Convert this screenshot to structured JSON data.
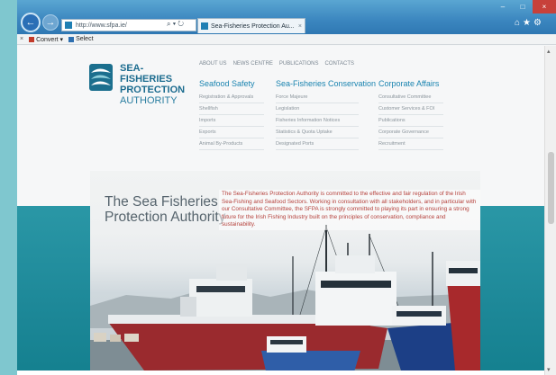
{
  "browser": {
    "address": "http://www.sfpa.ie/",
    "address_tools": "⌕ ▾ ↻",
    "tab_title": "Sea-Fisheries Protection Au...",
    "tab_close": "×",
    "window_controls": {
      "min": "–",
      "max": "□",
      "close": "×"
    },
    "right_icons": "⌂★⚙",
    "back_glyph": "←",
    "forward_glyph": "→"
  },
  "command_bar": {
    "close": "×",
    "convert": "Convert ▾",
    "select": "Select"
  },
  "logo": {
    "line1": "SEA-FISHERIES",
    "line2": "PROTECTION",
    "line3": "AUTHORITY"
  },
  "topnav": [
    "ABOUT US",
    "NEWS CENTRE",
    "PUBLICATIONS",
    "CONTACTS"
  ],
  "nav_columns": [
    {
      "heading": "Seafood Safety",
      "items": [
        "Registration & Approvals",
        "Shellfish",
        "Imports",
        "Exports",
        "Animal By-Products"
      ]
    },
    {
      "heading": "Sea-Fisheries Conservation",
      "items": [
        "Force Majeure",
        "Legislation",
        "Fisheries Information Notices",
        "Statistics & Quota Uptake",
        "Designated Ports"
      ]
    },
    {
      "heading": "Corporate Affairs",
      "items": [
        "Consultative Committee",
        "Customer Services & FOI",
        "Publications",
        "Corporate Governance",
        "Recruitment"
      ]
    }
  ],
  "hero": {
    "title": "The Sea Fisheries\nProtection Authority",
    "text": "The Sea-Fisheries Protection Authority is committed to the effective and fair regulation of the Irish Sea-Fishing and Seafood Sectors. Working in consultation with all stakeholders, and in particular with our Consultative Committee, the SFPA is strongly committed to playing its part in ensuring a strong future for the Irish Fishing Industry built on the principles of conservation, compliance and sustainability."
  },
  "colors": {
    "brand_teal": "#1c6c8f",
    "nav_heading": "#1a84b0",
    "hero_text": "#b5403b",
    "hero_band": "#1d8898"
  },
  "scrollbar": {
    "up": "▴",
    "down": "▾"
  }
}
